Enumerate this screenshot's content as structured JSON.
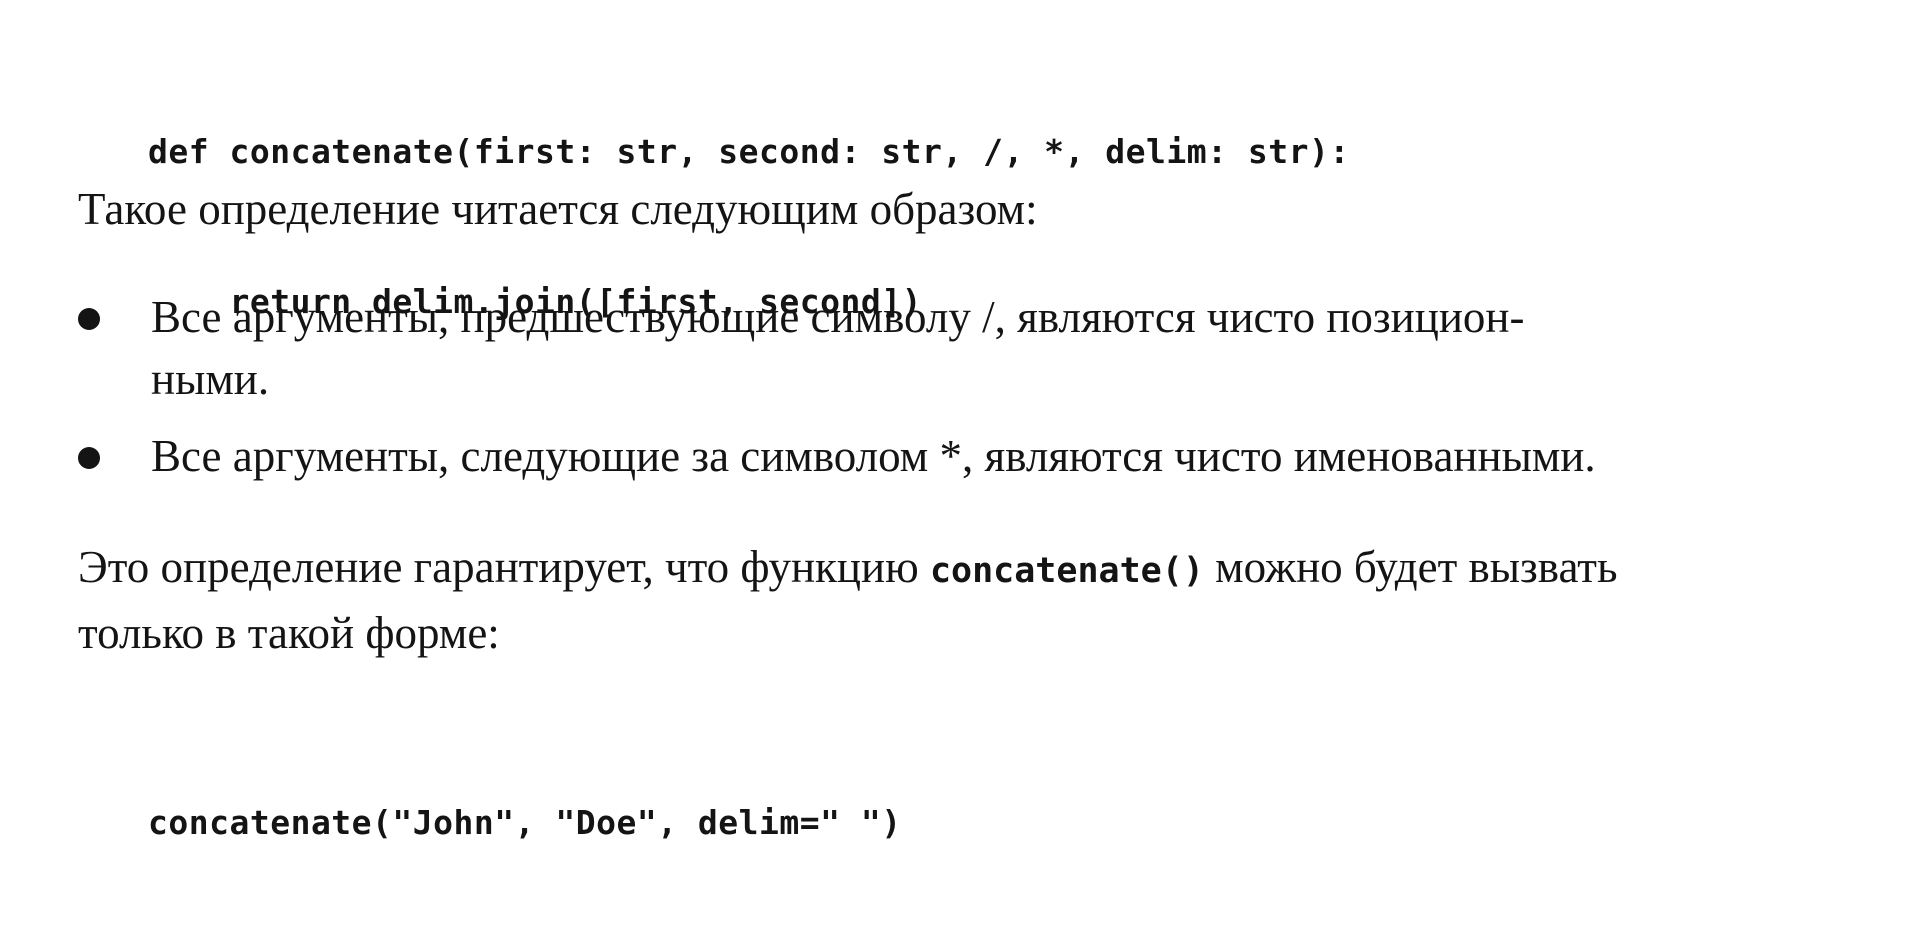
{
  "code_block_1": {
    "line_1": "def concatenate(first: str, second: str, /, *, delim: str):",
    "line_2": "    return delim.join([first, second])"
  },
  "paragraph_1": "Такое определение читается следующим образом:",
  "bullets": [
    {
      "line_1": "Все аргументы, предшествующие символу /, являются чисто позицион-",
      "line_2": "ными."
    },
    {
      "line_1": "Все аргументы, следующие за символом *, являются чисто именованными."
    }
  ],
  "paragraph_2": {
    "before_code": "Это определение гарантирует, что функцию ",
    "inline_code": "concatenate()",
    "after_code": " можно будет вызвать",
    "line_2": "только в такой форме:"
  },
  "code_block_2": {
    "line_1": "concatenate(\"John\", \"Doe\", delim=\" \")"
  }
}
